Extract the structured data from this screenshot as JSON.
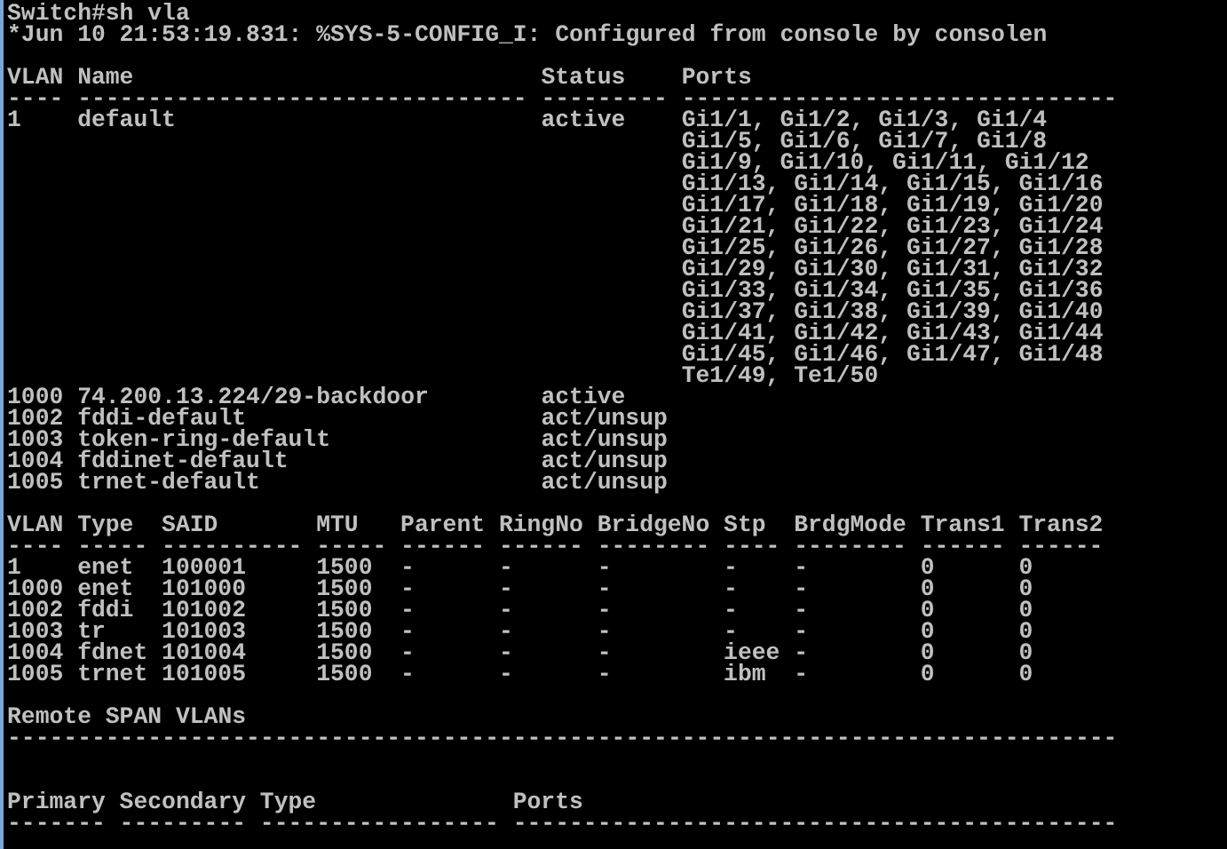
{
  "terminal": {
    "sections": [
      {
        "kind": "command",
        "lines": [
          "Switch#sh vla",
          "*Jun 10 21:53:19.831: %SYS-5-CONFIG_I: Configured from console by consolen"
        ]
      },
      {
        "kind": "vlan_status",
        "columns": [
          "VLAN",
          "Name",
          "Status",
          "Ports"
        ],
        "rules": [
          "----",
          "--------------------------------",
          "---------",
          "-------------------------------"
        ],
        "rows": [
          [
            "1",
            "default",
            "active",
            [
              "Gi1/1, Gi1/2, Gi1/3, Gi1/4",
              "Gi1/5, Gi1/6, Gi1/7, Gi1/8",
              "Gi1/9, Gi1/10, Gi1/11, Gi1/12",
              "Gi1/13, Gi1/14, Gi1/15, Gi1/16",
              "Gi1/17, Gi1/18, Gi1/19, Gi1/20",
              "Gi1/21, Gi1/22, Gi1/23, Gi1/24",
              "Gi1/25, Gi1/26, Gi1/27, Gi1/28",
              "Gi1/29, Gi1/30, Gi1/31, Gi1/32",
              "Gi1/33, Gi1/34, Gi1/35, Gi1/36",
              "Gi1/37, Gi1/38, Gi1/39, Gi1/40",
              "Gi1/41, Gi1/42, Gi1/43, Gi1/44",
              "Gi1/45, Gi1/46, Gi1/47, Gi1/48",
              "Te1/49, Te1/50"
            ]
          ],
          [
            "1000",
            "74.200.13.224/29-backdoor",
            "active"
          ],
          [
            "1002",
            "fddi-default",
            "act/unsup"
          ],
          [
            "1003",
            "token-ring-default",
            "act/unsup"
          ],
          [
            "1004",
            "fddinet-default",
            "act/unsup"
          ],
          [
            "1005",
            "trnet-default",
            "act/unsup"
          ]
        ]
      },
      {
        "kind": "vlan_params",
        "columns": [
          "VLAN",
          "Type",
          "SAID",
          "MTU",
          "Parent",
          "RingNo",
          "BridgeNo",
          "Stp",
          "BrdgMode",
          "Trans1",
          "Trans2"
        ],
        "rules": [
          "----",
          "-----",
          "----------",
          "-----",
          "------",
          "------",
          "--------",
          "----",
          "--------",
          "------",
          "------"
        ],
        "rows": [
          [
            "1",
            "enet",
            "100001",
            "1500",
            "-",
            "-",
            "-",
            "-",
            "-",
            "0",
            "0"
          ],
          [
            "1000",
            "enet",
            "101000",
            "1500",
            "-",
            "-",
            "-",
            "-",
            "-",
            "0",
            "0"
          ],
          [
            "1002",
            "fddi",
            "101002",
            "1500",
            "-",
            "-",
            "-",
            "-",
            "-",
            "0",
            "0"
          ],
          [
            "1003",
            "tr",
            "101003",
            "1500",
            "-",
            "-",
            "-",
            "-",
            "-",
            "0",
            "0"
          ],
          [
            "1004",
            "fdnet",
            "101004",
            "1500",
            "-",
            "-",
            "-",
            "ieee",
            "-",
            "0",
            "0"
          ],
          [
            "1005",
            "trnet",
            "101005",
            "1500",
            "-",
            "-",
            "-",
            "ibm",
            "-",
            "0",
            "0"
          ]
        ]
      },
      {
        "kind": "banner",
        "title": "Remote SPAN VLANs",
        "rule": "-------------------------------------------------------------------------------"
      },
      {
        "kind": "private_vlans",
        "columns": [
          "Primary",
          "Secondary",
          "Type",
          "Ports"
        ],
        "rules": [
          "-------",
          "---------",
          "-----------------",
          "-------------------------------------------"
        ]
      }
    ]
  }
}
